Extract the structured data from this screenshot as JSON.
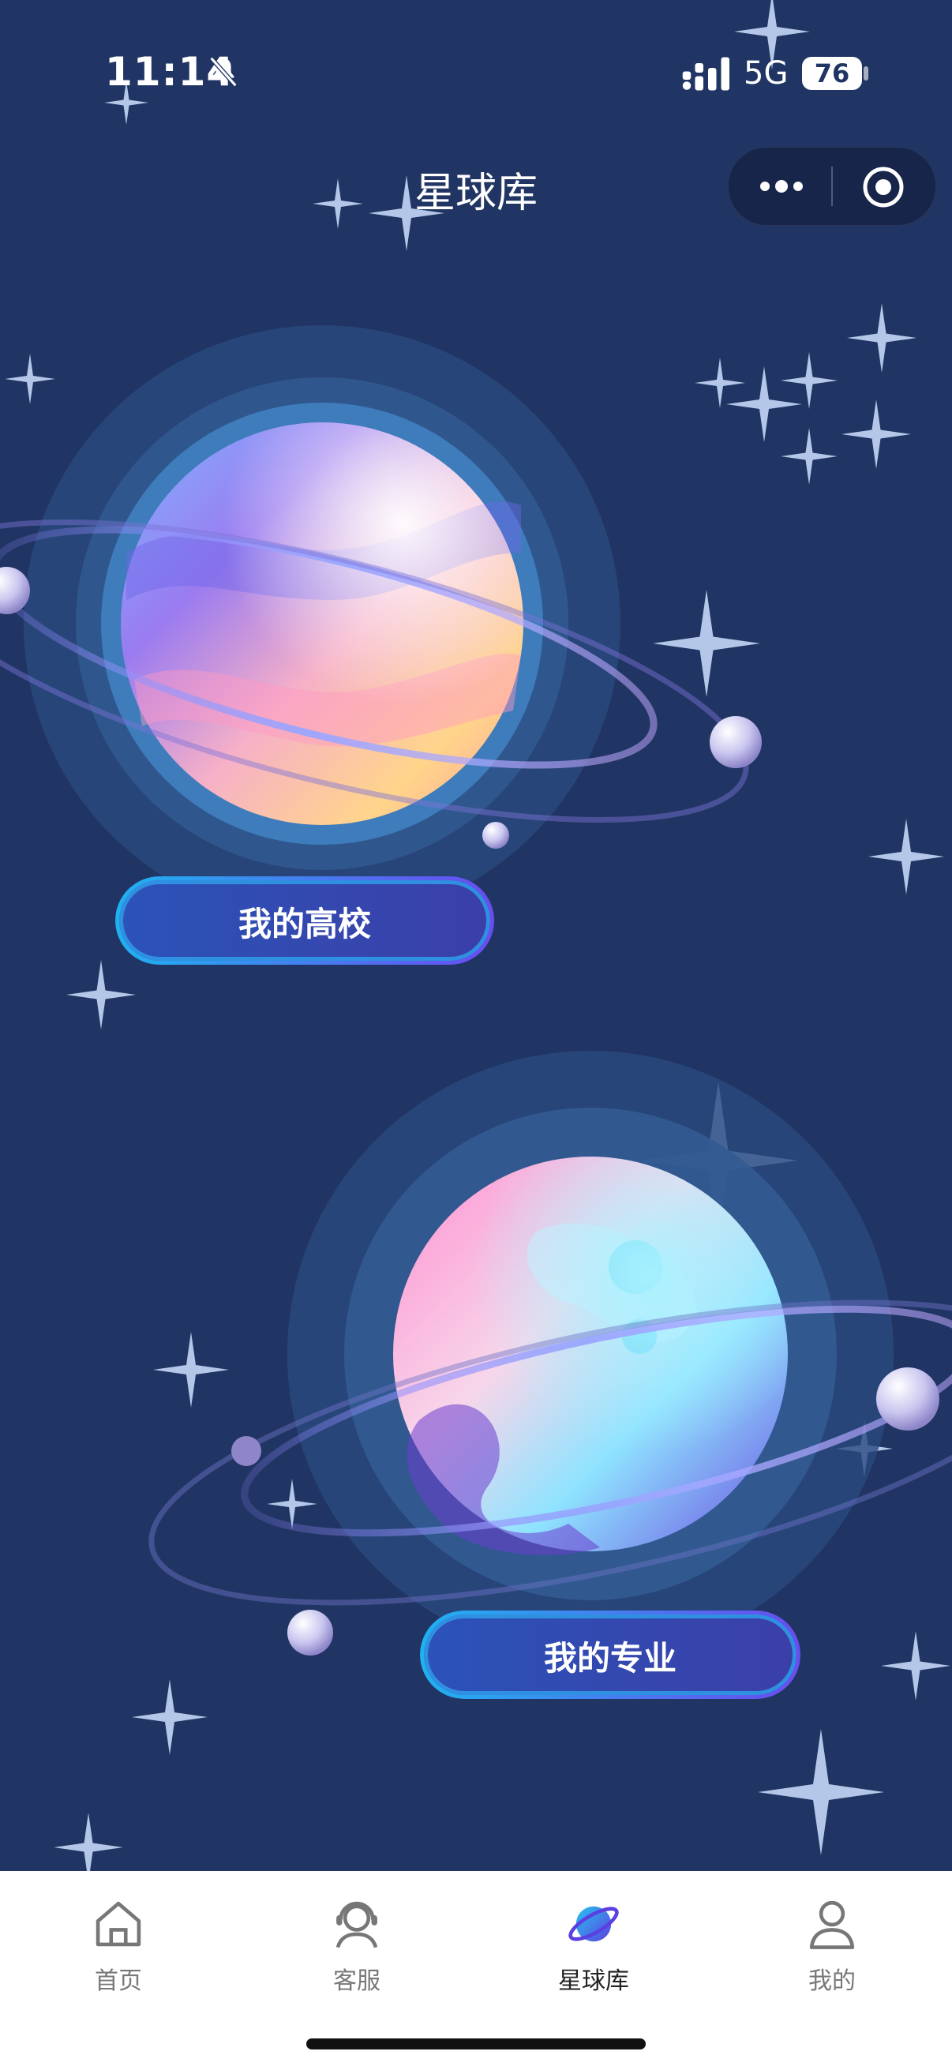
{
  "status_bar": {
    "time": "11:14",
    "network": "5G",
    "battery": "76",
    "icons": [
      "bell-muted-icon",
      "signal-icon",
      "battery-icon"
    ]
  },
  "nav": {
    "title": "星球库",
    "capsule_icons": [
      "more-icon",
      "close-target-icon"
    ]
  },
  "planets": {
    "college_button": "我的高校",
    "major_button": "我的专业"
  },
  "tabbar": {
    "items": [
      {
        "label": "首页",
        "icon": "home-icon",
        "active": false
      },
      {
        "label": "客服",
        "icon": "headset-icon",
        "active": false
      },
      {
        "label": "星球库",
        "icon": "planet-icon",
        "active": true
      },
      {
        "label": "我的",
        "icon": "user-icon",
        "active": false
      }
    ]
  },
  "colors": {
    "background": "#213564",
    "tab_active": "#222222",
    "tab_inactive": "#777777"
  }
}
